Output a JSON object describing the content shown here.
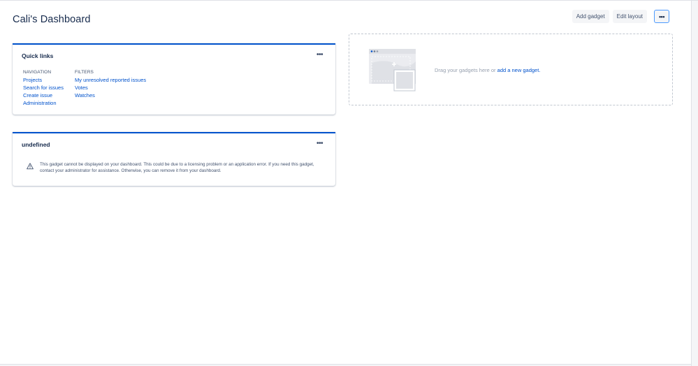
{
  "page": {
    "title": "Cali's Dashboard"
  },
  "toolbar": {
    "add_gadget": "Add gadget",
    "edit_layout": "Edit layout",
    "more": "•••"
  },
  "quick_links": {
    "title": "Quick links",
    "menu": "•••",
    "navigation": {
      "heading": "NAVIGATION",
      "items": [
        "Projects",
        "Search for issues",
        "Create issue",
        "Administration"
      ]
    },
    "filters": {
      "heading": "FILTERS",
      "items": [
        "My unresolved reported issues",
        "Votes",
        "Watches"
      ]
    }
  },
  "undefined_gadget": {
    "title": "undefined",
    "menu": "•••",
    "message": "This gadget cannot be displayed on your dashboard. This could be due to a licensing problem or an application error. If you need this gadget, contact your administrator for assistance. Otherwise, you can remove it from your dashboard."
  },
  "dropzone": {
    "text": "Drag your gadgets here or",
    "link": "add a new gadget."
  },
  "colors": {
    "accent": "#0052cc",
    "focus": "#4c9aff",
    "text": "#172b4d",
    "muted": "#97a0af"
  }
}
